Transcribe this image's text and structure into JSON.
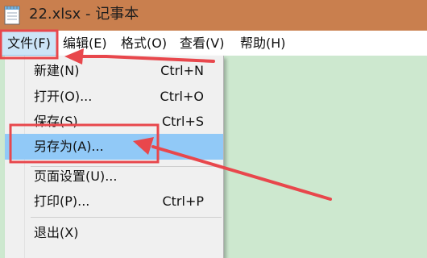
{
  "window": {
    "title": "22.xlsx - 记事本",
    "icon": "notepad-icon"
  },
  "menubar": {
    "items": [
      {
        "label": "文件(F)",
        "active": true
      },
      {
        "label": "编辑(E)"
      },
      {
        "label": "格式(O)"
      },
      {
        "label": "查看(V)"
      },
      {
        "label": "帮助(H)"
      }
    ]
  },
  "file_menu": {
    "items": [
      {
        "label": "新建(N)",
        "shortcut": "Ctrl+N"
      },
      {
        "label": "打开(O)...",
        "shortcut": "Ctrl+O"
      },
      {
        "label": "保存(S)",
        "shortcut": "Ctrl+S"
      },
      {
        "label": "另存为(A)...",
        "shortcut": "",
        "highlighted": true
      },
      {
        "label": "页面设置(U)...",
        "shortcut": ""
      },
      {
        "label": "打印(P)...",
        "shortcut": "Ctrl+P"
      },
      {
        "label": "退出(X)",
        "shortcut": ""
      }
    ]
  },
  "colors": {
    "titlebar": "#c97f4e",
    "editor_background": "#cde8cf",
    "menu_highlight": "#91c9f7",
    "annotation": "#e8474c"
  }
}
